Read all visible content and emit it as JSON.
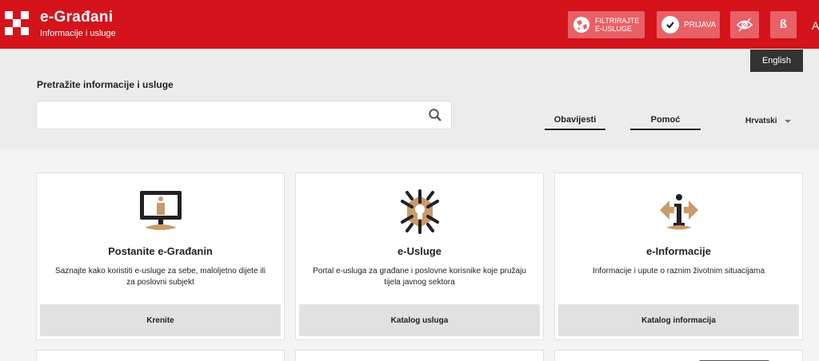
{
  "header": {
    "title": "e-Građani",
    "subtitle": "Informacije i usluge",
    "filter_label_line1": "FILTRIRAJTE",
    "filter_label_line2": "E-USLUGE",
    "login_label": "PRIJAVA",
    "font_label": "ß",
    "a_label": "A",
    "language_button": "English",
    "colors": {
      "brand_red": "#d4131b",
      "button_pink": "#e76167"
    }
  },
  "search": {
    "title": "Pretražite informacije i usluge",
    "placeholder": "",
    "value": ""
  },
  "nav": {
    "tab1": "Obavijesti",
    "tab2": "Pomoć",
    "language_select": "Hrvatski"
  },
  "cards": [
    {
      "icon": "person-screen-icon",
      "title": "Postanite e-Građanin",
      "description": "Saznajte kako koristiti e-usluge za sebe, maloljetno dijete ili za poslovni subjekt",
      "button": "Krenite"
    },
    {
      "icon": "keyhole-star-icon",
      "title": "e-Usluge",
      "description": "Portal e-usluga za građane i poslovne korisnike koje pružaju tijela javnog sektora",
      "button": "Katalog usluga"
    },
    {
      "icon": "info-arrows-icon",
      "title": "e-Informacije",
      "description": "Informacije i upute o raznim životnim situacijama",
      "button": "Katalog informacija"
    }
  ]
}
